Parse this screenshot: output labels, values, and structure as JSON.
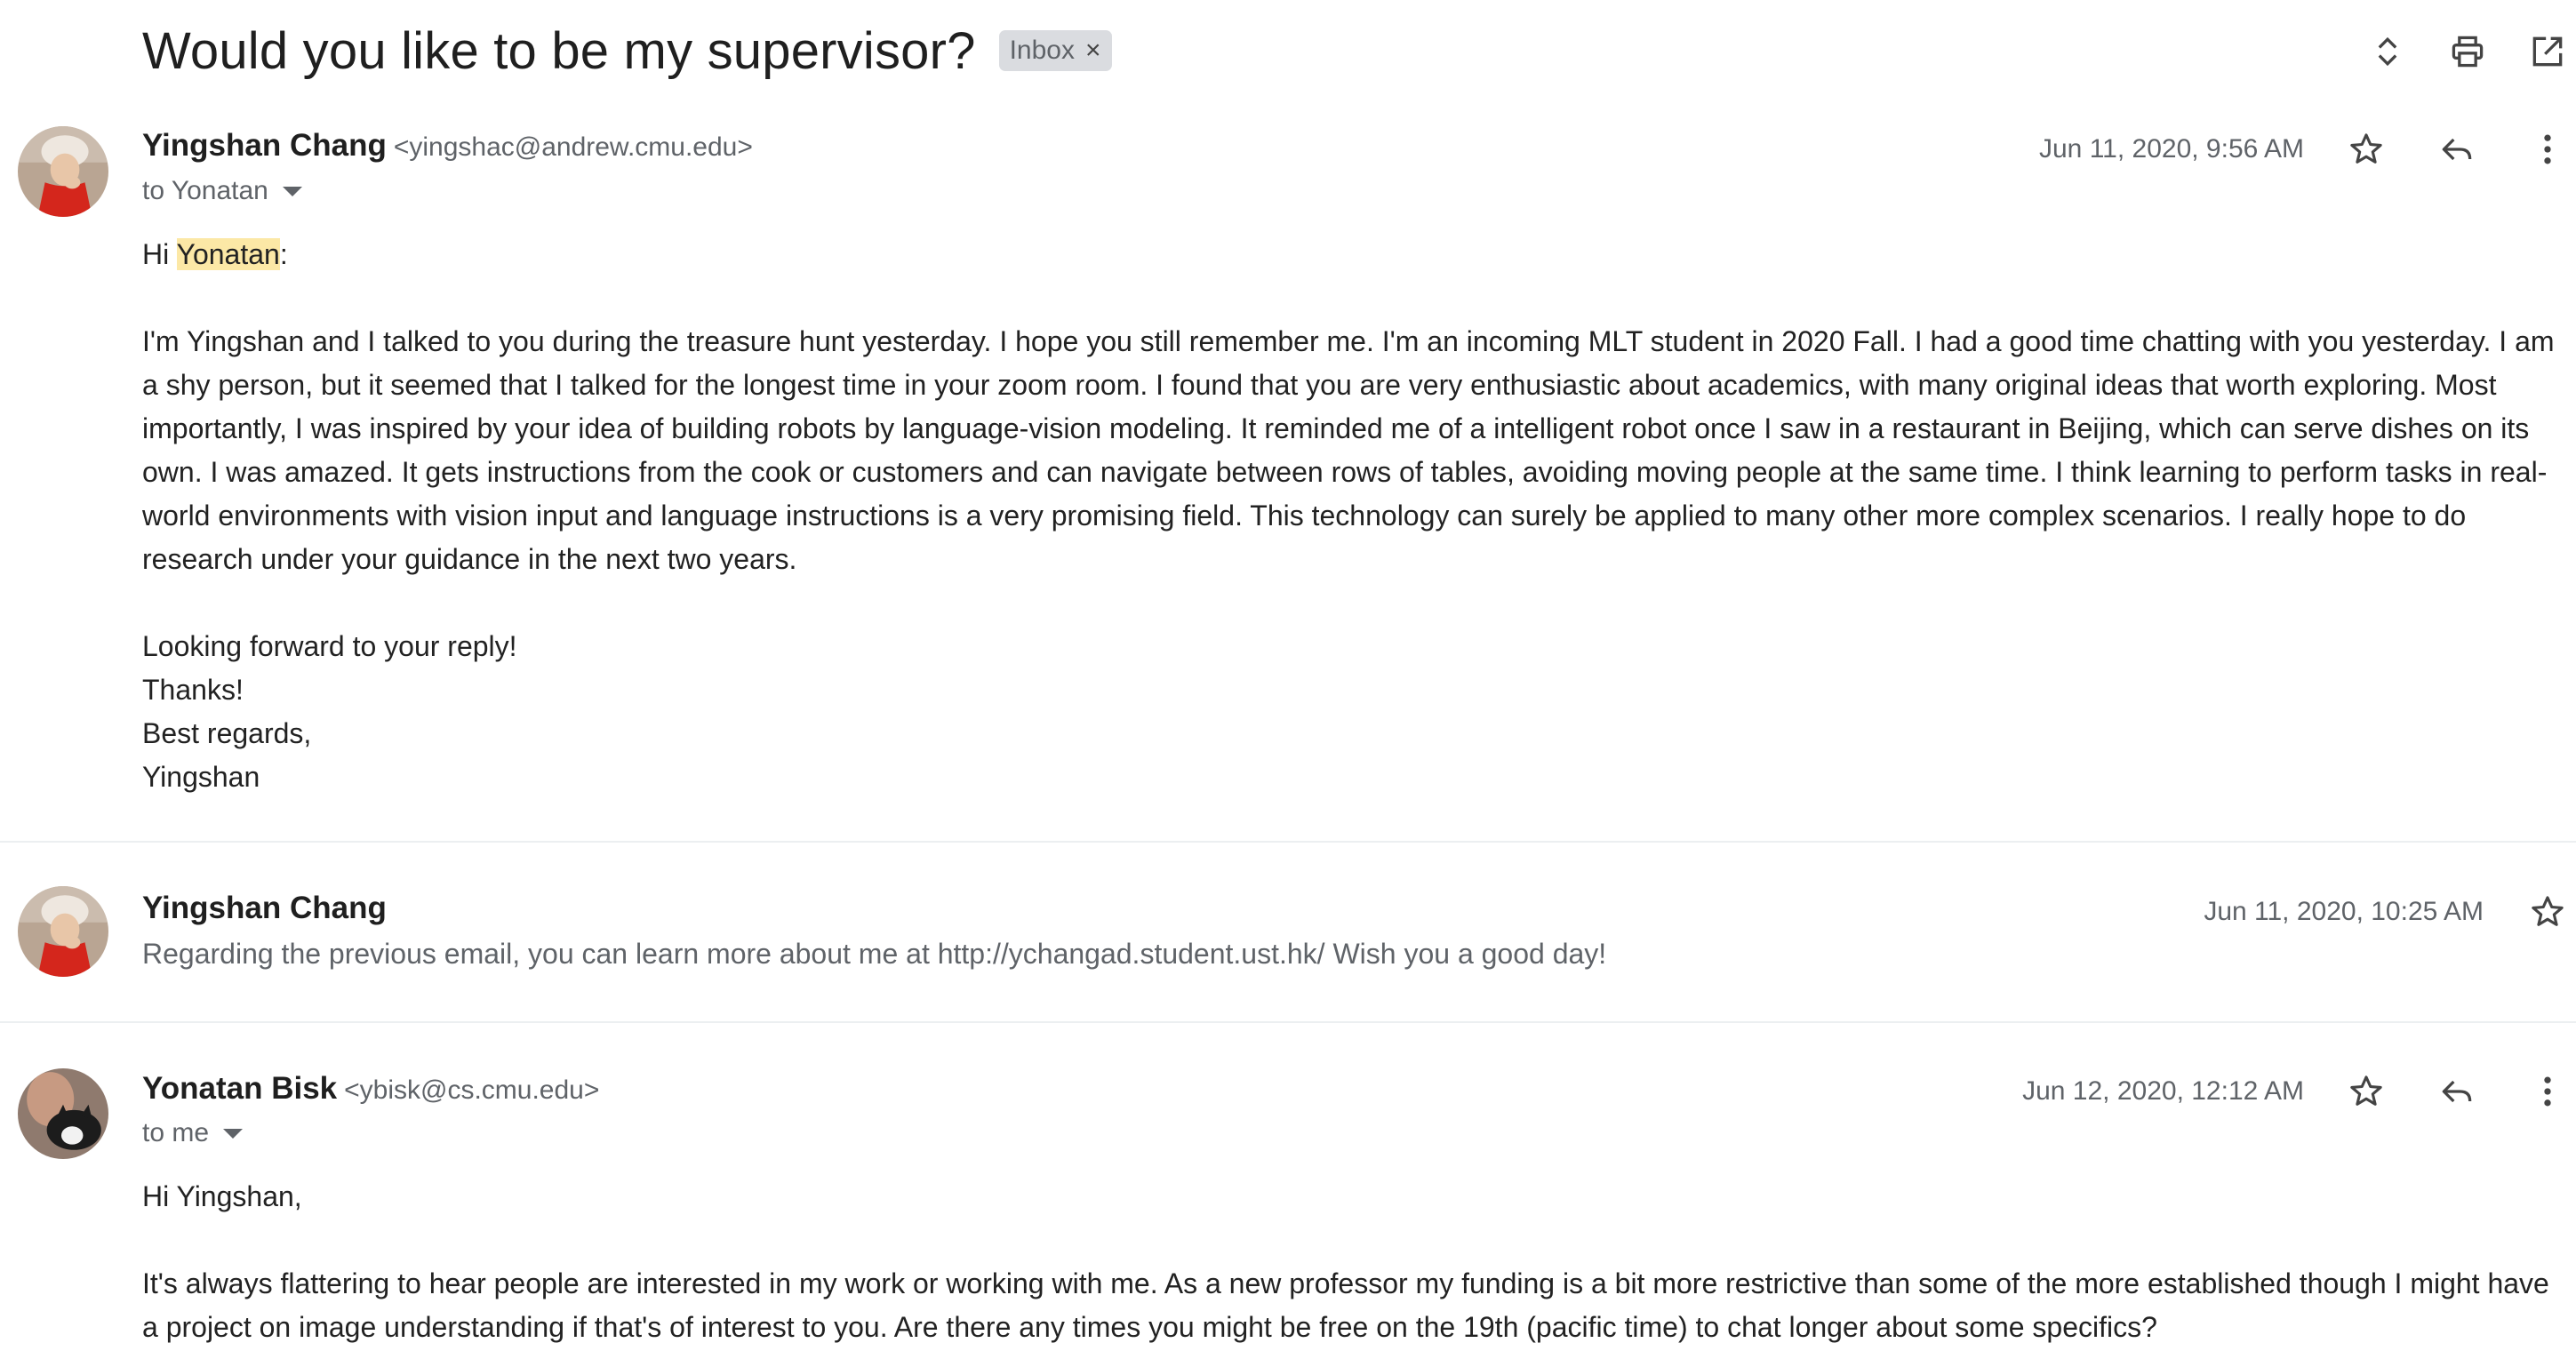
{
  "thread": {
    "subject": "Would you like to be my supervisor?",
    "label": "Inbox",
    "label_remove_glyph": "×",
    "actions": [
      "expand-collapse-icon",
      "print-icon",
      "open-new-window-icon"
    ]
  },
  "messages": [
    {
      "sender_name": "Yingshan Chang",
      "sender_email": "<yingshac@andrew.cmu.edu>",
      "recipient": "to Yonatan",
      "date": "Jun 11, 2020, 9:56 AM",
      "greeting_prefix": "Hi ",
      "greeting_highlight": "Yonatan",
      "greeting_suffix": ":",
      "paragraph1": "I'm Yingshan and I talked to you during the treasure hunt yesterday. I hope you still remember me. I'm an incoming MLT student in 2020 Fall. I had a good time chatting with you yesterday. I am a shy person, but it seemed that I talked for the longest time in your zoom room. I found that you are very enthusiastic about academics, with many original ideas that worth exploring. Most importantly, I was inspired by your idea of building robots by language-vision modeling. It reminded me of a intelligent robot once I saw in a restaurant in Beijing, which can serve dishes on its own. I was amazed. It gets instructions from the cook or customers and can navigate between rows of tables, avoiding moving people at the same time. I think learning to perform tasks in real-world environments with vision input and language instructions is a very promising field. This technology can surely be applied to many other more complex scenarios. I really hope to do research under your guidance in the next two years.",
      "closing": [
        "Looking forward to your reply!",
        "Thanks!",
        "Best regards,",
        "Yingshan"
      ]
    },
    {
      "sender_name": "Yingshan Chang",
      "date": "Jun 11, 2020, 10:25 AM",
      "snippet": "Regarding the previous email, you can learn more about me at http://ychangad.student.ust.hk/ Wish you a good day!"
    },
    {
      "sender_name": "Yonatan Bisk",
      "sender_email": "<ybisk@cs.cmu.edu>",
      "recipient": "to me",
      "date": "Jun 12, 2020, 12:12 AM",
      "greeting": "Hi Yingshan,",
      "paragraph1": "It's always flattering to hear people are interested in my work or working with me.  As a new professor my funding is a bit more restrictive than some of the more established though I might have a project on image understanding if that's of interest to you.  Are there any times you might be free on the 19th (pacific time) to chat longer about some specifics?"
    }
  ],
  "colors": {
    "highlight": "#fce8a6",
    "chip_bg": "#dadce0",
    "muted_text": "#5f6368",
    "divider": "#eceff1"
  }
}
